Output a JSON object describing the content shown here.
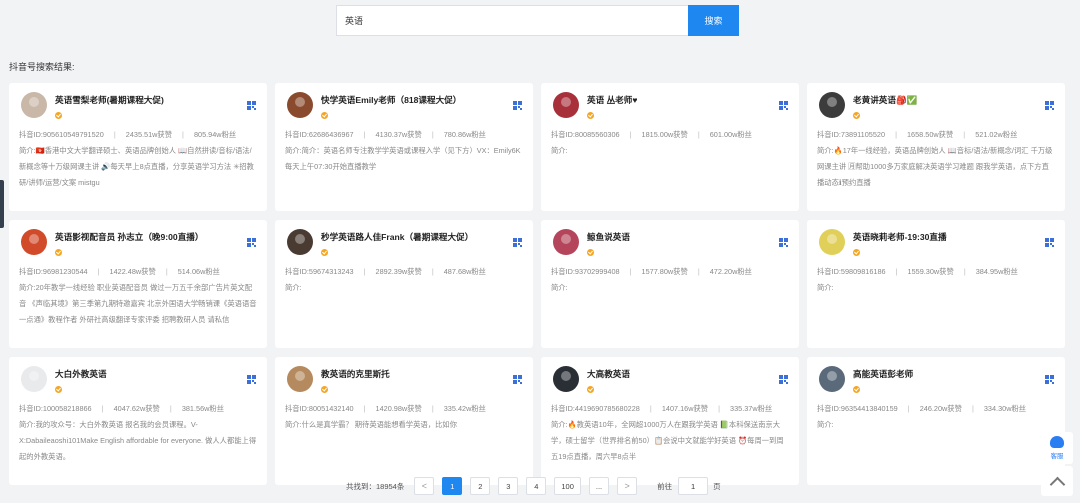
{
  "search": {
    "value": "英语",
    "button_label": "搜索"
  },
  "results_title": "抖音号搜索结果:",
  "labels": {
    "id_prefix": "抖音ID:",
    "intro_prefix": "简介:"
  },
  "cards": [
    {
      "name": "英语雪梨老师(暑期课程大促)",
      "id": "905610549791520",
      "likes": "2435.51w获赞",
      "fans": "805.94w粉丝",
      "intro": "🇭🇰香港中文大学翻译硕士、英语品牌创始人 📖自然拼读/音标/语法/新概念等十万级网课主讲 🔊每天早上8点直播，分享英语学习方法 ✳招教研/讲师/运营/文案 mistgu",
      "avatar_color": "#c9b7a8"
    },
    {
      "name": "快学英语Emily老师（818课程大促）",
      "id": "62686436967",
      "likes": "4130.37w获赞",
      "fans": "780.86w粉丝",
      "intro": "简介：英语名师专注教学学英语或课程入学（见下方）VX：Emily6K每天上午07:30开始直播教学",
      "avatar_color": "#8a4a2e"
    },
    {
      "name": "英语 丛老师♥",
      "id": "80085560306",
      "likes": "1815.00w获赞",
      "fans": "601.00w粉丝",
      "intro": "",
      "avatar_color": "#a8303a"
    },
    {
      "name": "老黄讲英语🎒✅",
      "id": "73891105520",
      "likes": "1658.50w获赞",
      "fans": "521.02w粉丝",
      "intro": "🔥17年一线经验，英语品牌创始人 📖音标/语法/新概念/词汇 千万级网课主讲 🈷帮助1000多万家庭解决英语学习难题 跟我学英语，点下方直播动态ℹ预约直播",
      "avatar_color": "#3c3c3c"
    },
    {
      "name": "英语影视配音员 孙志立（晚9:00直播）",
      "id": "96981230544",
      "likes": "1422.48w获赞",
      "fans": "514.06w粉丝",
      "intro": "20年教学一线经验 职业英语配音员 做过一万五千余部广告片英文配音 《声临其境》第三季第九期特邀嘉宾 北京外国语大学畅销课《英语语音一点通》教程作者 外研社高级翻译专家评委 招聘教研人员 请私信",
      "avatar_color": "#d14a2a"
    },
    {
      "name": "秒学英语路人佳Frank（暑期课程大促）",
      "id": "59674313243",
      "likes": "2892.39w获赞",
      "fans": "487.68w粉丝",
      "intro": "",
      "avatar_color": "#4a3b32"
    },
    {
      "name": "鲸鱼说英语",
      "id": "93702999408",
      "likes": "1577.80w获赞",
      "fans": "472.20w粉丝",
      "intro": "",
      "avatar_color": "#b5455a"
    },
    {
      "name": "英语晓莉老师-19:30直播",
      "id": "59809816186",
      "likes": "1559.30w获赞",
      "fans": "384.95w粉丝",
      "intro": "",
      "avatar_color": "#e0d05a"
    },
    {
      "name": "大白外教英语",
      "id": "100058218866",
      "likes": "4047.62w获赞",
      "fans": "381.56w粉丝",
      "intro": "我的攻众号：大白外教英语 报名我的会员课程。V-X:Dabaileaoshi101Make English affordable for everyone. 做人人都能上得起的外教英语。",
      "avatar_color": "#e8eaec"
    },
    {
      "name": "教英语的克里斯托",
      "id": "80051432140",
      "likes": "1420.98w获赞",
      "fans": "335.42w粉丝",
      "intro": "什么是真学霸？ 期待英语能想看学英语，比如你",
      "avatar_color": "#b58a5e"
    },
    {
      "name": "大高教英语",
      "id": "4419690785680228",
      "likes": "1407.16w获赞",
      "fans": "335.37w粉丝",
      "intro": "🔥教英语10年，全网超1000万人在跟我学英语 📗本科保送南京大学，硕士留学（世界排名前50）📋会说中文就能学好英语 ⏰每周一到周五19点直播，周六早8点半",
      "avatar_color": "#2a2f36"
    },
    {
      "name": "高能英语彭老师",
      "id": "96354413840159",
      "likes": "246.20w获赞",
      "fans": "334.30w粉丝",
      "intro": "",
      "avatar_color": "#5a6a7a"
    }
  ],
  "pagination": {
    "total": "共找到：18954条",
    "prev": "<",
    "pages": [
      "1",
      "2",
      "3",
      "4",
      "100",
      "..."
    ],
    "active_page": "1",
    "next": ">",
    "goto_label": "前往",
    "goto_value": "1",
    "goto_unit": "页"
  },
  "floating": {
    "service_label": "客服"
  },
  "colors": {
    "primary": "#1e87f0",
    "verify": "#f5a623",
    "page_bg": "#f2f3f5"
  }
}
